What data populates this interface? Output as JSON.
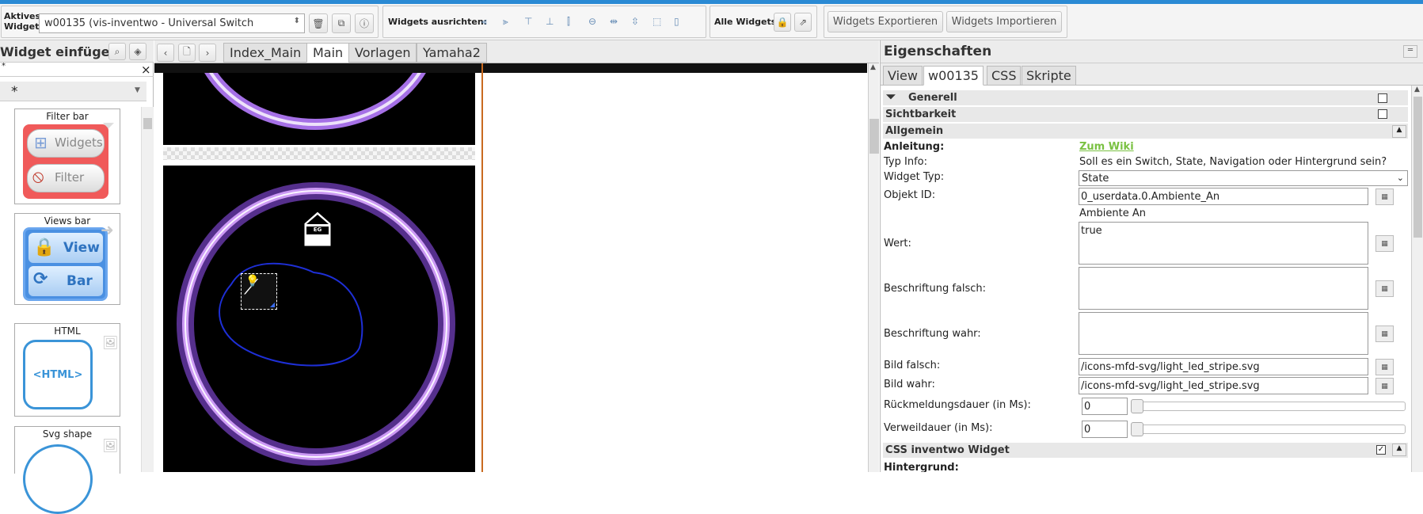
{
  "toolbar": {
    "active_widget_label": "Aktives Widget:",
    "active_widget_value": "w00135 (vis-inventwo - Universal Switch",
    "align_label": "Widgets ausrichten:",
    "all_widgets_label": "Alle Widgets:",
    "export_label": "Widgets Exportieren",
    "import_label": "Widgets Importieren"
  },
  "left_panel": {
    "title": "Widget einfügen",
    "filter_value": "*",
    "close_glyph": "×",
    "tiles": [
      {
        "title": "Filter bar",
        "btn1": "Widgets",
        "btn2": "Filter"
      },
      {
        "title": "Views bar",
        "btn1": "View",
        "btn2": "Bar"
      },
      {
        "title": "HTML",
        "content": "<HTML>"
      },
      {
        "title": "Svg shape"
      }
    ]
  },
  "view_tabs": [
    {
      "label": "Index_Main"
    },
    {
      "label": "Main"
    },
    {
      "label": "Vorlagen"
    },
    {
      "label": "Yamaha2"
    }
  ],
  "canvas": {
    "house_label": "EG"
  },
  "properties": {
    "title": "Eigenschaften",
    "tabs": [
      "View",
      "w00135",
      "CSS",
      "Skripte"
    ],
    "sections": {
      "generell": "Generell",
      "sichtbarkeit": "Sichtbarkeit",
      "allgemein": "Allgemein",
      "css_inventwo": "CSS inventwo Widget",
      "hintergrund": "Hintergrund:"
    },
    "anleitung_label": "Anleitung:",
    "anleitung_link": "Zum Wiki",
    "typ_info_label": "Typ Info:",
    "typ_info_value": "Soll es ein Switch, State, Navigation oder Hintergrund sein?",
    "widget_typ_label": "Widget Typ:",
    "widget_typ_value": "State",
    "objekt_id_label": "Objekt ID:",
    "objekt_id_value": "0_userdata.0.Ambiente_An",
    "objekt_name": "Ambiente An",
    "wert_label": "Wert:",
    "wert_value": "true",
    "beschriftung_falsch_label": "Beschriftung falsch:",
    "beschriftung_wahr_label": "Beschriftung wahr:",
    "bild_falsch_label": "Bild falsch:",
    "bild_falsch_value": "/icons-mfd-svg/light_led_stripe.svg",
    "bild_wahr_label": "Bild wahr:",
    "bild_wahr_value": "/icons-mfd-svg/light_led_stripe.svg",
    "rueckmeldung_label": "Rückmeldungsdauer (in Ms):",
    "rueckmeldung_value": "0",
    "verweildauer_label": "Verweildauer (in Ms):",
    "verweildauer_value": "0",
    "pick_button": "▦"
  },
  "colors": {
    "accent": "#2a8ad4",
    "link": "#7ac142",
    "filter_tile": "#f05a5a",
    "views_tile": "#4a90e2",
    "ring": "#b77cff"
  }
}
